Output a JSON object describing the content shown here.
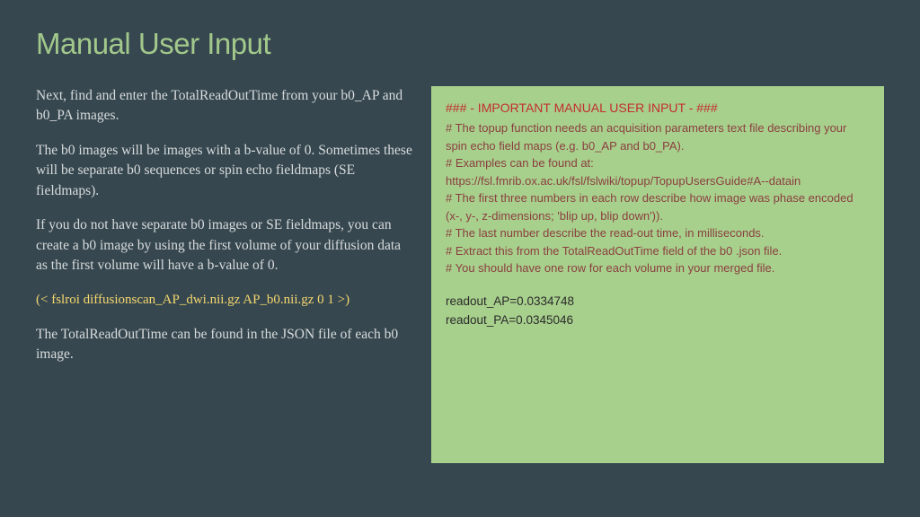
{
  "title": "Manual User Input",
  "left": {
    "p1": "Next, find and enter the TotalReadOutTime from your b0_AP and b0_PA images.",
    "p2": "The b0 images will be images with a b-value of 0. Sometimes these will be separate b0 sequences or spin echo fieldmaps (SE fieldmaps).",
    "p3": "If you do not have separate b0 images or SE fieldmaps, you can create a b0 image by using the first volume of your diffusion data as the first volume will have a b-value of 0.",
    "cmd": "(< fslroi diffusionscan_AP_dwi.nii.gz AP_b0.nii.gz 0 1 >)",
    "p4": "The TotalReadOutTime can be found in the JSON file of each b0 image."
  },
  "right": {
    "header": "### - IMPORTANT MANUAL USER INPUT - ###",
    "c1": "# The topup function needs an acquisition parameters text file describing your spin echo field maps (e.g. b0_AP and b0_PA).",
    "c2": "# Examples can be found at:",
    "c3": "https://fsl.fmrib.ox.ac.uk/fsl/fslwiki/topup/TopupUsersGuide#A--datain",
    "c4": "# The first three numbers in each row describe how image was phase encoded (x-, y-, z-dimensions; 'blip up, blip down')).",
    "c5": "# The last number describe the read-out time, in milliseconds.",
    "c6": "# Extract this from the  TotalReadOutTime  field of the b0 .json file.",
    "c7": "# You should have one row for each volume in your merged file.",
    "v1": "readout_AP=0.0334748",
    "v2": "readout_PA=0.0345046"
  }
}
